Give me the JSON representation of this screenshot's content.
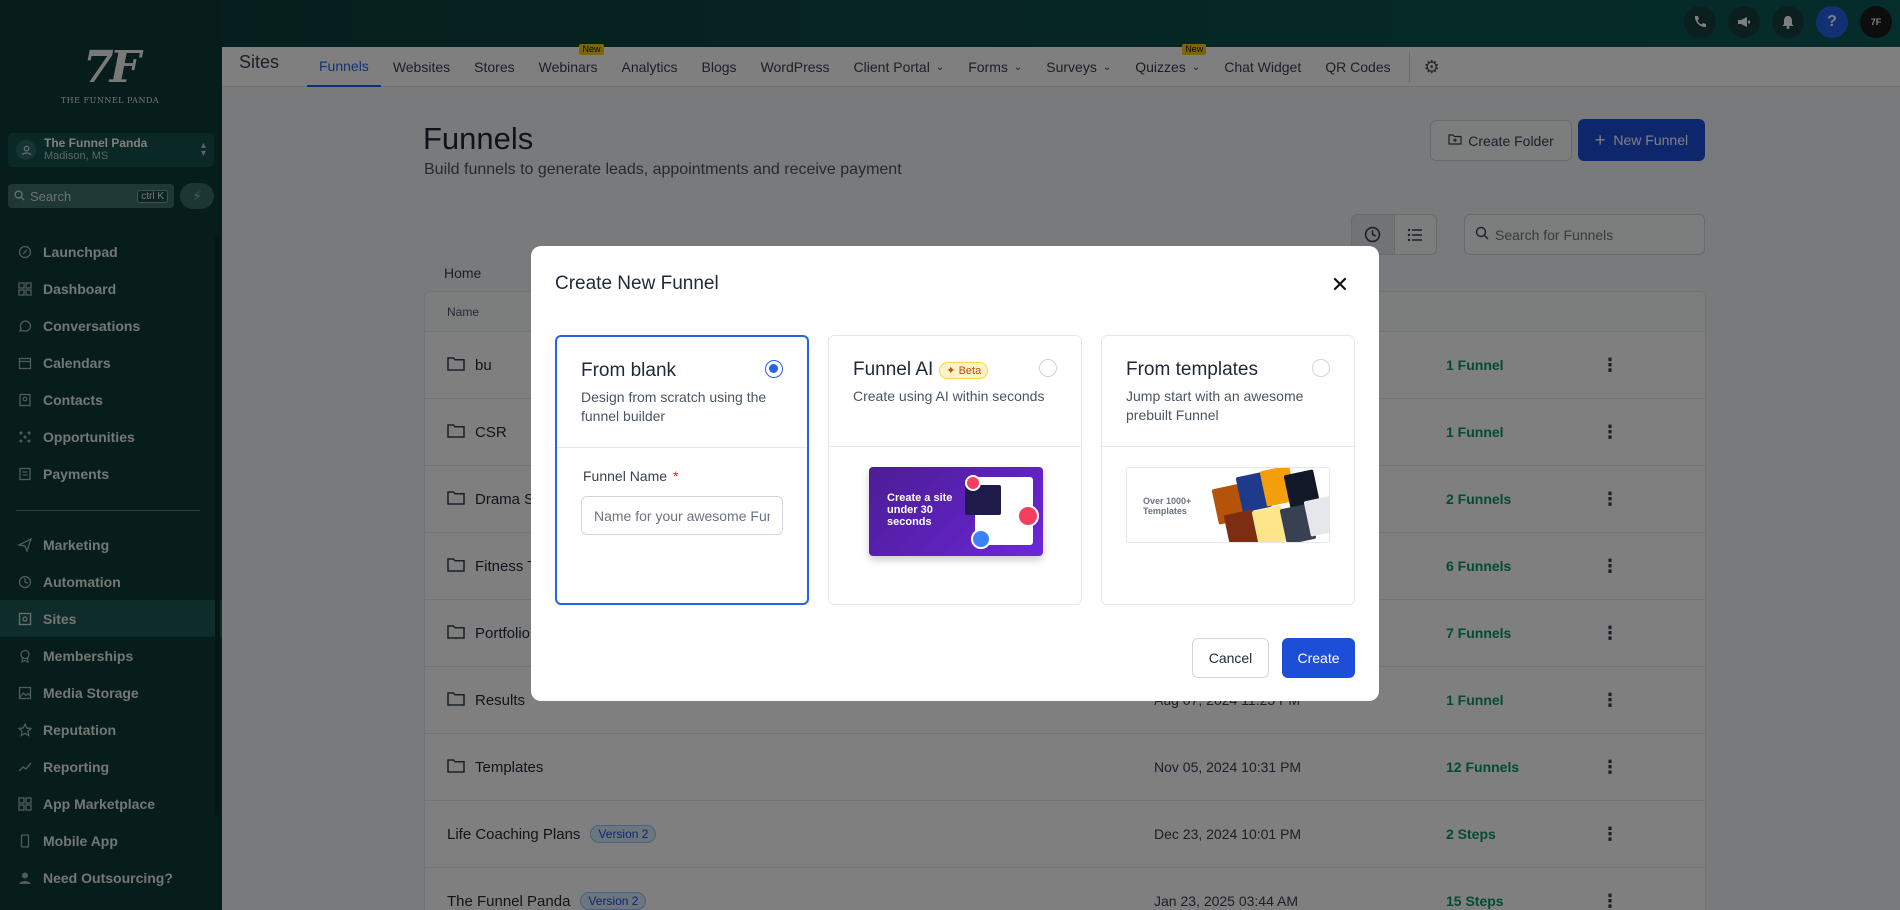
{
  "topbar": {
    "icons": [
      "phone-icon",
      "megaphone-icon",
      "bell-icon",
      "help-icon",
      "avatar"
    ],
    "help_label": "?",
    "avatar_label": "7F"
  },
  "sidebar": {
    "logo_mark": "7F",
    "logo_text": "THE FUNNEL PANDA",
    "account": {
      "name": "The Funnel Panda",
      "location": "Madison, MS"
    },
    "search": {
      "placeholder": "Search",
      "shortcut": "ctrl K"
    },
    "items": [
      {
        "label": "Launchpad",
        "icon": "rocket-icon"
      },
      {
        "label": "Dashboard",
        "icon": "grid-icon"
      },
      {
        "label": "Conversations",
        "icon": "chat-icon"
      },
      {
        "label": "Calendars",
        "icon": "calendar-icon"
      },
      {
        "label": "Contacts",
        "icon": "contacts-icon"
      },
      {
        "label": "Opportunities",
        "icon": "opportunities-icon"
      },
      {
        "label": "Payments",
        "icon": "payments-icon"
      }
    ],
    "items2": [
      {
        "label": "Marketing",
        "icon": "send-icon"
      },
      {
        "label": "Automation",
        "icon": "automation-icon"
      },
      {
        "label": "Sites",
        "icon": "sites-icon",
        "active": true
      },
      {
        "label": "Memberships",
        "icon": "badge-icon"
      },
      {
        "label": "Media Storage",
        "icon": "image-icon"
      },
      {
        "label": "Reputation",
        "icon": "star-icon"
      },
      {
        "label": "Reporting",
        "icon": "trend-icon"
      },
      {
        "label": "App Marketplace",
        "icon": "apps-icon"
      },
      {
        "label": "Mobile App",
        "icon": "mobile-icon"
      },
      {
        "label": "Need Outsourcing?",
        "icon": "user-icon"
      }
    ]
  },
  "subnav": {
    "section": "Sites",
    "tabs": [
      {
        "label": "Funnels",
        "active": true
      },
      {
        "label": "Websites"
      },
      {
        "label": "Stores"
      },
      {
        "label": "Webinars",
        "badge": "New"
      },
      {
        "label": "Analytics"
      },
      {
        "label": "Blogs"
      },
      {
        "label": "WordPress"
      },
      {
        "label": "Client Portal",
        "dropdown": true
      },
      {
        "label": "Forms",
        "dropdown": true
      },
      {
        "label": "Surveys",
        "dropdown": true
      },
      {
        "label": "Quizzes",
        "dropdown": true,
        "badge": "New"
      },
      {
        "label": "Chat Widget"
      },
      {
        "label": "QR Codes"
      }
    ]
  },
  "page": {
    "title": "Funnels",
    "subtitle": "Build funnels to generate leads, appointments and receive payment",
    "create_folder": "Create Folder",
    "new_funnel": "New Funnel",
    "search_placeholder": "Search for Funnels",
    "breadcrumb": "Home",
    "table": {
      "header_name": "Name",
      "rows": [
        {
          "name": "bu",
          "folder": true,
          "date": "",
          "count": "1 Funnel"
        },
        {
          "name": "CSR",
          "folder": true,
          "date": "",
          "count": "1 Funnel"
        },
        {
          "name": "Drama S",
          "folder": true,
          "date": "",
          "count": "2 Funnels"
        },
        {
          "name": "Fitness T",
          "folder": true,
          "date": "",
          "count": "6 Funnels"
        },
        {
          "name": "Portfolio",
          "folder": true,
          "date": "",
          "count": "7 Funnels"
        },
        {
          "name": "Results",
          "folder": true,
          "date": "Aug 07, 2024 11:23 PM",
          "count": "1 Funnel"
        },
        {
          "name": "Templates",
          "folder": true,
          "date": "Nov 05, 2024 10:31 PM",
          "count": "12 Funnels"
        },
        {
          "name": "Life Coaching Plans",
          "folder": false,
          "version": "Version 2",
          "date": "Dec 23, 2024 10:01 PM",
          "count": "2 Steps"
        },
        {
          "name": "The Funnel Panda",
          "folder": false,
          "version": "Version 2",
          "date": "Jan 23, 2025 03:44 AM",
          "count": "15 Steps"
        }
      ]
    }
  },
  "modal": {
    "title": "Create New Funnel",
    "options": [
      {
        "title": "From blank",
        "desc": "Design from scratch using the funnel builder",
        "selected": true
      },
      {
        "title": "Funnel AI",
        "badge": "Beta",
        "desc": "Create using AI within seconds",
        "thumb_text": "Create a site under 30 seconds"
      },
      {
        "title": "From templates",
        "desc": "Jump start with an awesome prebuilt Funnel",
        "thumb_text": "Over 1000+ Templates"
      }
    ],
    "field_label": "Funnel Name",
    "field_required": "*",
    "field_placeholder": "Name for your awesome Funnel",
    "field_value": "",
    "cancel": "Cancel",
    "create": "Create"
  },
  "colors": {
    "accent": "#1d4ed8",
    "sidebar_bg": "#0e3b38",
    "success": "#059669"
  }
}
